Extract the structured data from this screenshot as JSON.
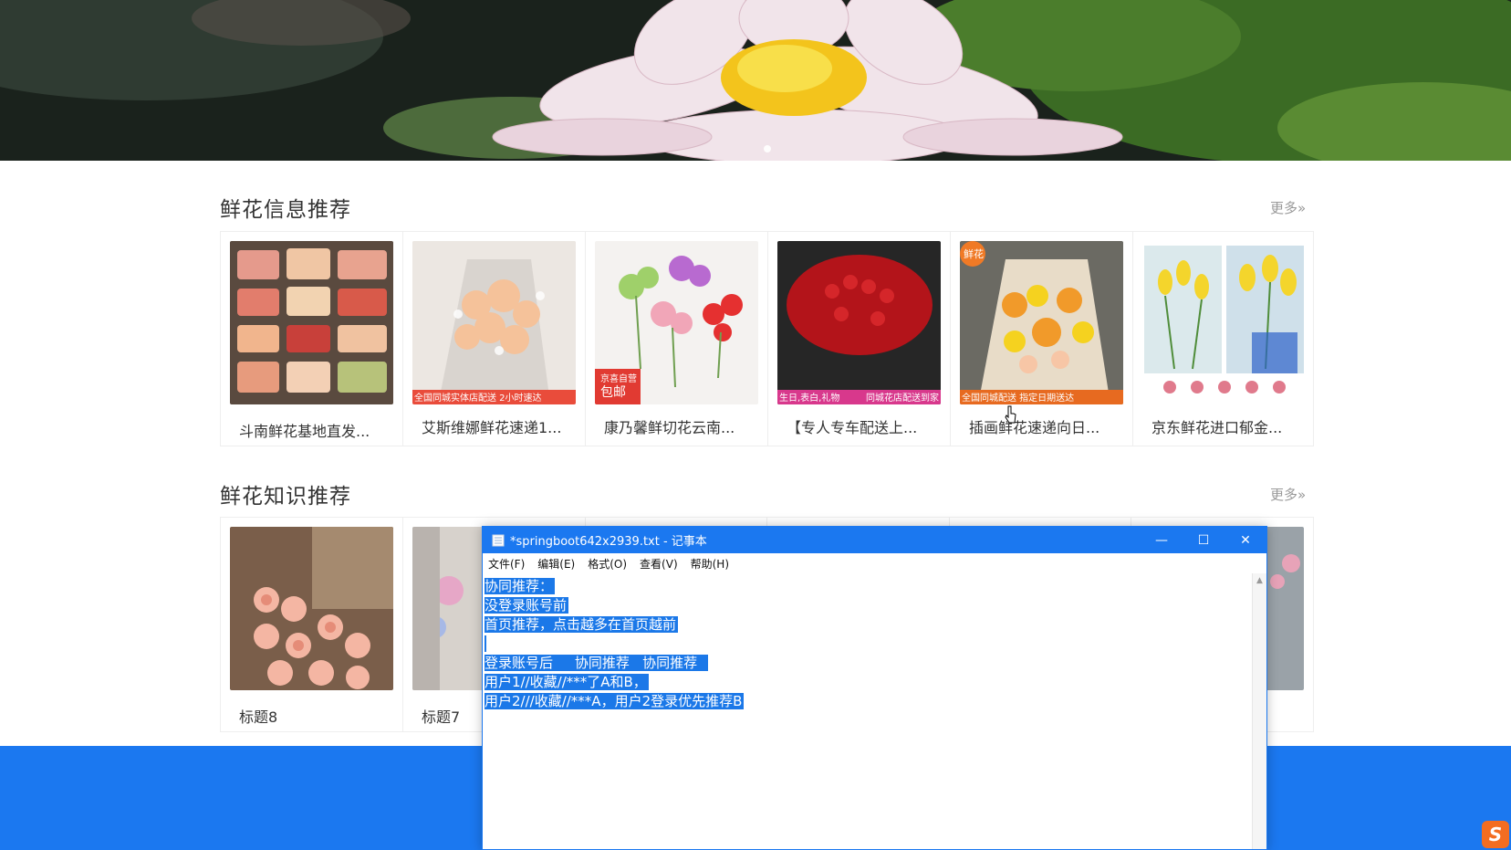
{
  "hero": {
    "icon": "water-lily-banner"
  },
  "section1": {
    "title": "鲜花信息推荐",
    "more": "更多»",
    "items": [
      {
        "name": "斗南鲜花基地直发..."
      },
      {
        "name": "艾斯维娜鲜花速递1..."
      },
      {
        "name": "康乃馨鲜切花云南..."
      },
      {
        "name": "【专人专车配送上..."
      },
      {
        "name": "插画鲜花速递向日..."
      },
      {
        "name": "京东鲜花进口郁金..."
      }
    ],
    "img_texts": {
      "i2_a": "全国同城实体店配送 2小时速达",
      "i3_a": "京喜自营",
      "i3_b": "包邮",
      "i4_a": "生日,表白,礼物",
      "i4_b": "同城花店配送到家",
      "i5_a": "鲜花",
      "i5_b": "全国同城配送 指定日期送达"
    }
  },
  "section2": {
    "title": "鲜花知识推荐",
    "more": "更多»",
    "items": [
      {
        "name": "标题8"
      },
      {
        "name": "标题7"
      }
    ]
  },
  "notepad": {
    "title": "*springboot642x2939.txt - 记事本",
    "menu": [
      "文件(F)",
      "编辑(E)",
      "格式(O)",
      "查看(V)",
      "帮助(H)"
    ],
    "lines": [
      "协同推荐：",
      "没登录账号前",
      "首页推荐，点击越多在首页越前",
      "",
      "登录账号后     协同推荐   协同推荐  ",
      "用户1//收藏//***了A和B，",
      "用户2///收藏//***A，用户2登录优先推荐B"
    ]
  },
  "colors": {
    "accent": "#1b78f0",
    "selection": "#1b78e8"
  }
}
